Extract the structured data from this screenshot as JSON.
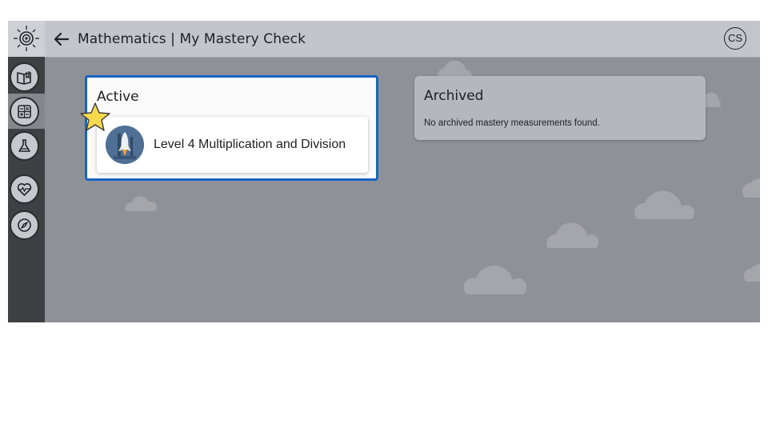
{
  "header": {
    "title": "Mathematics | My Mastery Check",
    "back_icon": "arrow-left-icon",
    "avatar_initials": "CS"
  },
  "sidebar": {
    "logo_icon": "sun-swirl-logo-icon",
    "items": [
      {
        "name": "reading",
        "icon": "book-icon"
      },
      {
        "name": "math",
        "icon": "calculator-icon",
        "active": true
      },
      {
        "name": "science",
        "icon": "flask-icon"
      },
      {
        "name": "health",
        "icon": "heart-pulse-icon"
      },
      {
        "name": "explore",
        "icon": "compass-icon"
      }
    ]
  },
  "active": {
    "title": "Active",
    "items": [
      {
        "label": "Level 4 Multiplication and Division",
        "icon": "rocket-icon"
      }
    ],
    "badge_icon": "star-icon"
  },
  "archived": {
    "title": "Archived",
    "empty_message": "No archived mastery measurements found."
  },
  "colors": {
    "background": "#8f9199",
    "sidebar": "#3f4043",
    "header": "#c4c5cc",
    "active_border": "#1565c0",
    "star": "#f7d94c"
  }
}
